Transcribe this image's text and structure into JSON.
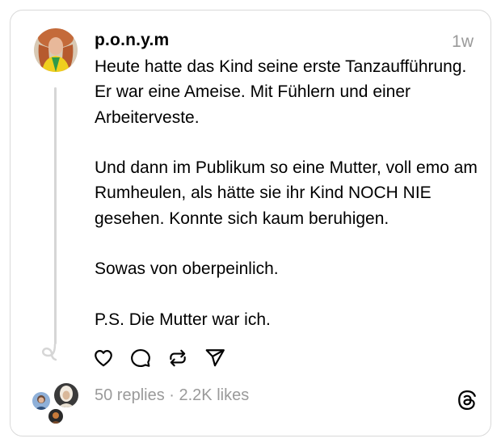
{
  "post": {
    "username": "p.o.n.y.m",
    "timestamp": "1w",
    "paragraphs": [
      "Heute hatte das Kind seine erste Tanzaufführung. Er war eine Ameise. Mit Fühlern und einer Arbeiterveste.",
      "Und dann im Publikum so eine Mutter, voll emo am Rumheulen, als hätte sie ihr Kind NOCH NIE gesehen. Konnte sich kaum beruhigen.",
      "Sowas von oberpeinlich.",
      "P.S. Die Mutter war ich."
    ],
    "stats": "50 replies · 2.2K likes"
  },
  "icons": {
    "like": "heart-icon",
    "reply": "comment-icon",
    "repost": "repost-icon",
    "share": "send-icon",
    "brand": "threads-logo-icon"
  },
  "colors": {
    "text": "#000000",
    "muted": "#9a9a9a",
    "border": "#d9d9d9",
    "thread_line": "#d6d6d6"
  }
}
